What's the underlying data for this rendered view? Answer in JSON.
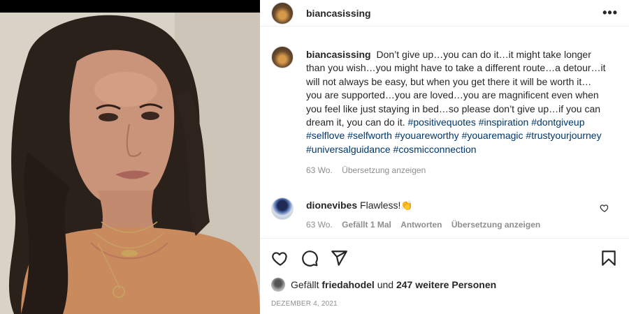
{
  "post": {
    "username": "biancasissing",
    "more_label": "•••"
  },
  "caption": {
    "username": "biancasissing",
    "text": "Don’t give up…you can do it…it might take longer than you wish…you might have to take a different route…a detour…it will not always be easy, but when you get there it will be worth it…you are supported…you are loved…you are magnificent even when you feel like just staying in bed…so please don’t give up…if you can dream it, you can do it.",
    "hashtags": [
      "#positivequotes",
      "#inspiration",
      "#dontgiveup",
      "#selflove",
      "#selfworth",
      "#youareworthy",
      "#youaremagic",
      "#trustyourjourney",
      "#universalguidance",
      "#cosmicconnection"
    ],
    "age": "63 Wo.",
    "translate": "Übersetzung anzeigen"
  },
  "comment": {
    "username": "dionevibes",
    "text": "Flawless!",
    "emoji": "👏",
    "age": "63 Wo.",
    "likes": "Gefällt 1 Mal",
    "reply": "Antworten",
    "translate": "Übersetzung anzeigen"
  },
  "likes": {
    "prefix": "Gefällt",
    "user": "friedahodel",
    "middle": "und",
    "count_text": "247 weitere Personen"
  },
  "date": "DEZEMBER 4, 2021",
  "icons": [
    "heart-icon",
    "comment-icon",
    "share-icon",
    "bookmark-icon"
  ]
}
